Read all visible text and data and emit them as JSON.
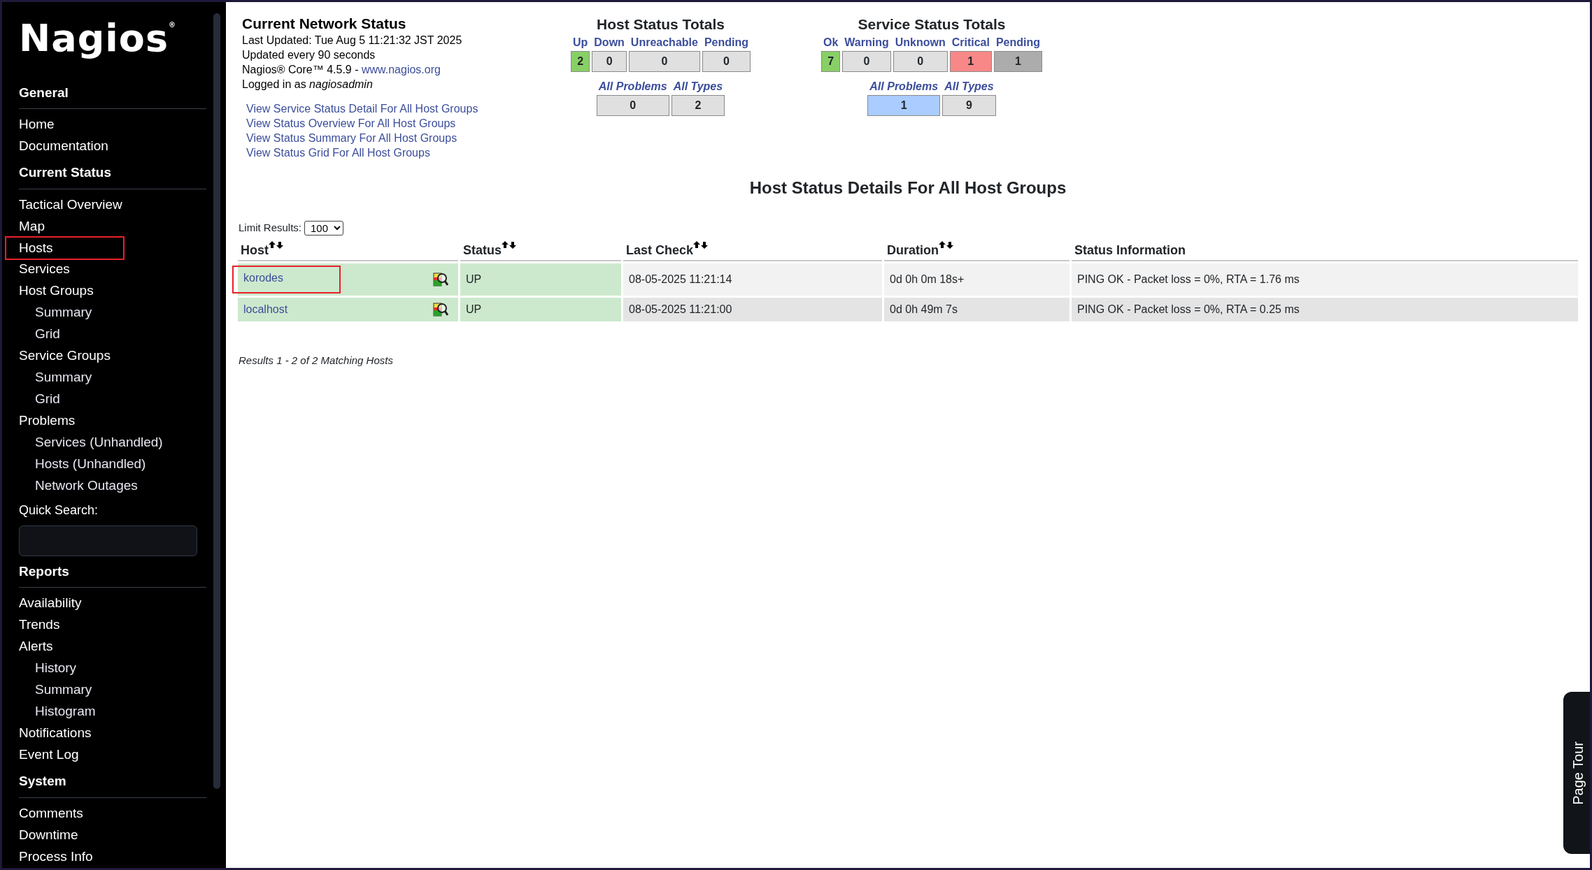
{
  "sidebar": {
    "logo": "Nagios",
    "logo_mark": "®",
    "sections": [
      {
        "heading": "General",
        "items": [
          {
            "label": "Home",
            "highlighted": false
          },
          {
            "label": "Documentation",
            "highlighted": false
          }
        ]
      },
      {
        "heading": "Current Status",
        "items": [
          {
            "label": "Tactical Overview",
            "highlighted": false
          },
          {
            "label": "Map",
            "highlighted": false
          },
          {
            "label": "Hosts",
            "highlighted": true
          },
          {
            "label": "Services",
            "highlighted": false
          },
          {
            "label": "Host Groups",
            "highlighted": false,
            "children": [
              {
                "label": "Summary",
                "highlighted": false
              },
              {
                "label": "Grid",
                "highlighted": false
              }
            ]
          },
          {
            "label": "Service Groups",
            "highlighted": false,
            "children": [
              {
                "label": "Summary",
                "highlighted": false
              },
              {
                "label": "Grid",
                "highlighted": false
              }
            ]
          },
          {
            "label": "Problems",
            "highlighted": false,
            "children": [
              {
                "label": "Services (Unhandled)",
                "highlighted": false
              },
              {
                "label": "Hosts (Unhandled)",
                "highlighted": false
              },
              {
                "label": "Network Outages",
                "highlighted": false
              }
            ]
          }
        ],
        "quick_search": {
          "label": "Quick Search:"
        }
      },
      {
        "heading": "Reports",
        "items": [
          {
            "label": "Availability",
            "highlighted": false
          },
          {
            "label": "Trends",
            "highlighted": false
          },
          {
            "label": "Alerts",
            "highlighted": false,
            "children": [
              {
                "label": "History",
                "highlighted": false
              },
              {
                "label": "Summary",
                "highlighted": false
              },
              {
                "label": "Histogram",
                "highlighted": false
              }
            ]
          },
          {
            "label": "Notifications",
            "highlighted": false
          },
          {
            "label": "Event Log",
            "highlighted": false
          }
        ]
      },
      {
        "heading": "System",
        "items": [
          {
            "label": "Comments",
            "highlighted": false
          },
          {
            "label": "Downtime",
            "highlighted": false
          },
          {
            "label": "Process Info",
            "highlighted": false
          }
        ]
      }
    ]
  },
  "network_status": {
    "title": "Current Network Status",
    "lines": [
      "Last Updated: Tue Aug 5 11:21:32 JST 2025",
      "Updated every 90 seconds"
    ],
    "version": "Nagios® Core™ 4.5.9 - ",
    "version_link": "www.nagios.org",
    "login": "Logged in as *nagiosadmin*",
    "links": [
      "View Service Status Detail For All Host Groups",
      "View Status Overview For All Host Groups",
      "View Status Summary For All Host Groups",
      "View Status Grid For All Host Groups"
    ]
  },
  "host_totals": {
    "title": "Host Status Totals",
    "states": [
      {
        "label": "Up",
        "value": "2",
        "color": "#88d066"
      },
      {
        "label": "Down",
        "value": "0",
        "color": "#e0e0e0"
      },
      {
        "label": "Unreachable",
        "value": "0",
        "color": "#e0e0e0"
      },
      {
        "label": "Pending",
        "value": "0",
        "color": "#e0e0e0"
      }
    ],
    "summary": [
      {
        "label": "All Problems",
        "value": "0",
        "color": "#e0e0e0"
      },
      {
        "label": "All Types",
        "value": "2",
        "color": "#e0e0e0"
      }
    ]
  },
  "service_totals": {
    "title": "Service Status Totals",
    "states": [
      {
        "label": "Ok",
        "value": "7",
        "color": "#88d066"
      },
      {
        "label": "Warning",
        "value": "0",
        "color": "#e0e0e0"
      },
      {
        "label": "Unknown",
        "value": "0",
        "color": "#e0e0e0"
      },
      {
        "label": "Critical",
        "value": "1",
        "color": "#f88888"
      },
      {
        "label": "Pending",
        "value": "1",
        "color": "#acacac"
      }
    ],
    "summary": [
      {
        "label": "All Problems",
        "value": "1",
        "color": "#aaccff"
      },
      {
        "label": "All Types",
        "value": "9",
        "color": "#e0e0e0"
      }
    ]
  },
  "details": {
    "title": "Host Status Details For All Host Groups",
    "limit_label": "Limit Results:",
    "limit_value": "100",
    "columns": [
      {
        "label": "Host",
        "sortable": true
      },
      {
        "label": "Status",
        "sortable": true
      },
      {
        "label": "Last Check",
        "sortable": true
      },
      {
        "label": "Duration",
        "sortable": true
      },
      {
        "label": "Status Information",
        "sortable": false
      }
    ],
    "rows": [
      {
        "host": "korodes",
        "highlighted": true,
        "color": "#cde9cd",
        "status": "UP",
        "last_check": "08-05-2025 11:21:14",
        "duration": "0d 0h 0m 18s+",
        "info": "PING OK - Packet loss = 0%, RTA = 1.76 ms"
      },
      {
        "host": "localhost",
        "highlighted": false,
        "color": "#cde9cd",
        "status": "UP",
        "last_check": "08-05-2025 11:21:00",
        "duration": "0d 0h 49m 7s",
        "info": "PING OK - Packet loss = 0%, RTA = 0.25 ms"
      }
    ],
    "results": "Results 1 - 2 of 2 Matching Hosts"
  },
  "page_tour": "Page Tour"
}
